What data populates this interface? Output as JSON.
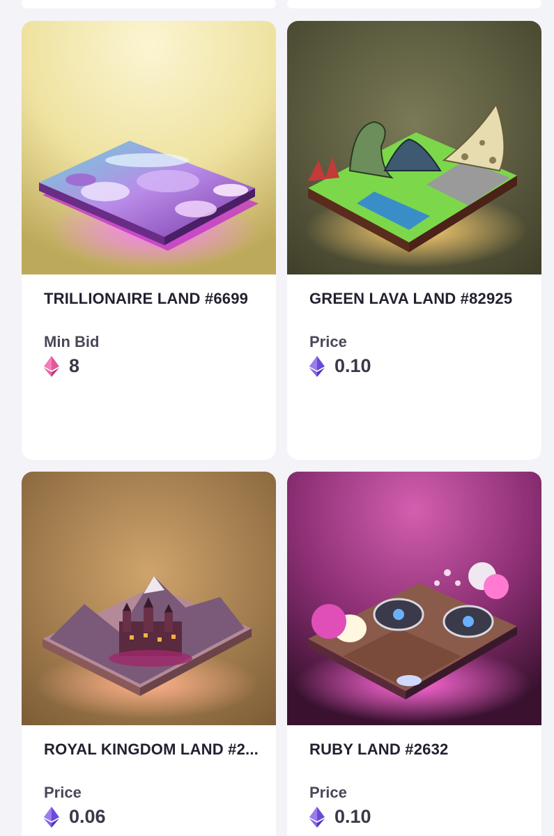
{
  "listings": [
    {
      "title": "TRILLIONAIRE LAND #6699",
      "price_label": "Min Bid",
      "price_value": "8",
      "currency_icon": "ethereum-pink-icon",
      "colors": {
        "bg": "#e8d98a",
        "glow": "#e04ee0"
      }
    },
    {
      "title": "GREEN LAVA LAND #82925",
      "price_label": "Price",
      "price_value": "0.10",
      "currency_icon": "ethereum-purple-icon",
      "colors": {
        "bg": "#5e5d3f",
        "glow": "#f2b44a"
      }
    },
    {
      "title": "ROYAL KINGDOM LAND #2...",
      "price_label": "Price",
      "price_value": "0.06",
      "currency_icon": "ethereum-purple-icon",
      "colors": {
        "bg": "#b8925e",
        "glow": "#f5a07a"
      }
    },
    {
      "title": "RUBY LAND #2632",
      "price_label": "Price",
      "price_value": "0.10",
      "currency_icon": "ethereum-purple-icon",
      "colors": {
        "bg": "#8a2f73",
        "glow": "#ff4fd3"
      }
    }
  ]
}
